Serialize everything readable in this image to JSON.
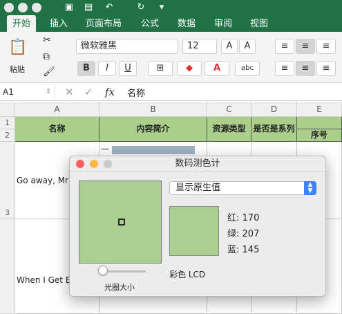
{
  "ribbon": {
    "tabs": [
      "开始",
      "插入",
      "页面布局",
      "公式",
      "数据",
      "审阅",
      "视图"
    ],
    "paste_label": "粘贴",
    "font_name": "微软雅黑",
    "font_size": "12",
    "bold": "B",
    "italic": "I",
    "underline": "U",
    "abc": "abc"
  },
  "formula_bar": {
    "name_box": "A1",
    "fx": "fx",
    "content": "名称"
  },
  "sheet": {
    "columns": [
      "A",
      "B",
      "C",
      "D",
      "E"
    ],
    "rows": [
      "1",
      "2",
      "3"
    ],
    "headers": {
      "a": "名称",
      "b": "内容简介",
      "c": "资源类型",
      "d": "是否是系列",
      "e": "序号"
    },
    "row3_a": "Go away, Mr W",
    "row4_a": "When I Get Big",
    "row3_b_fragment": "一"
  },
  "color_meter": {
    "title": "数码测色计",
    "dropdown_value": "显示原生值",
    "red_label": "红:",
    "red_value": "170",
    "green_label": "绿:",
    "green_value": "207",
    "blue_label": "蓝:",
    "blue_value": "145",
    "display": "彩色 LCD",
    "aperture_label": "光圈大小",
    "sampled_color": "#aacf91"
  },
  "colors": {
    "excel_green": "#217346",
    "header_fill": "#aacf8a"
  }
}
